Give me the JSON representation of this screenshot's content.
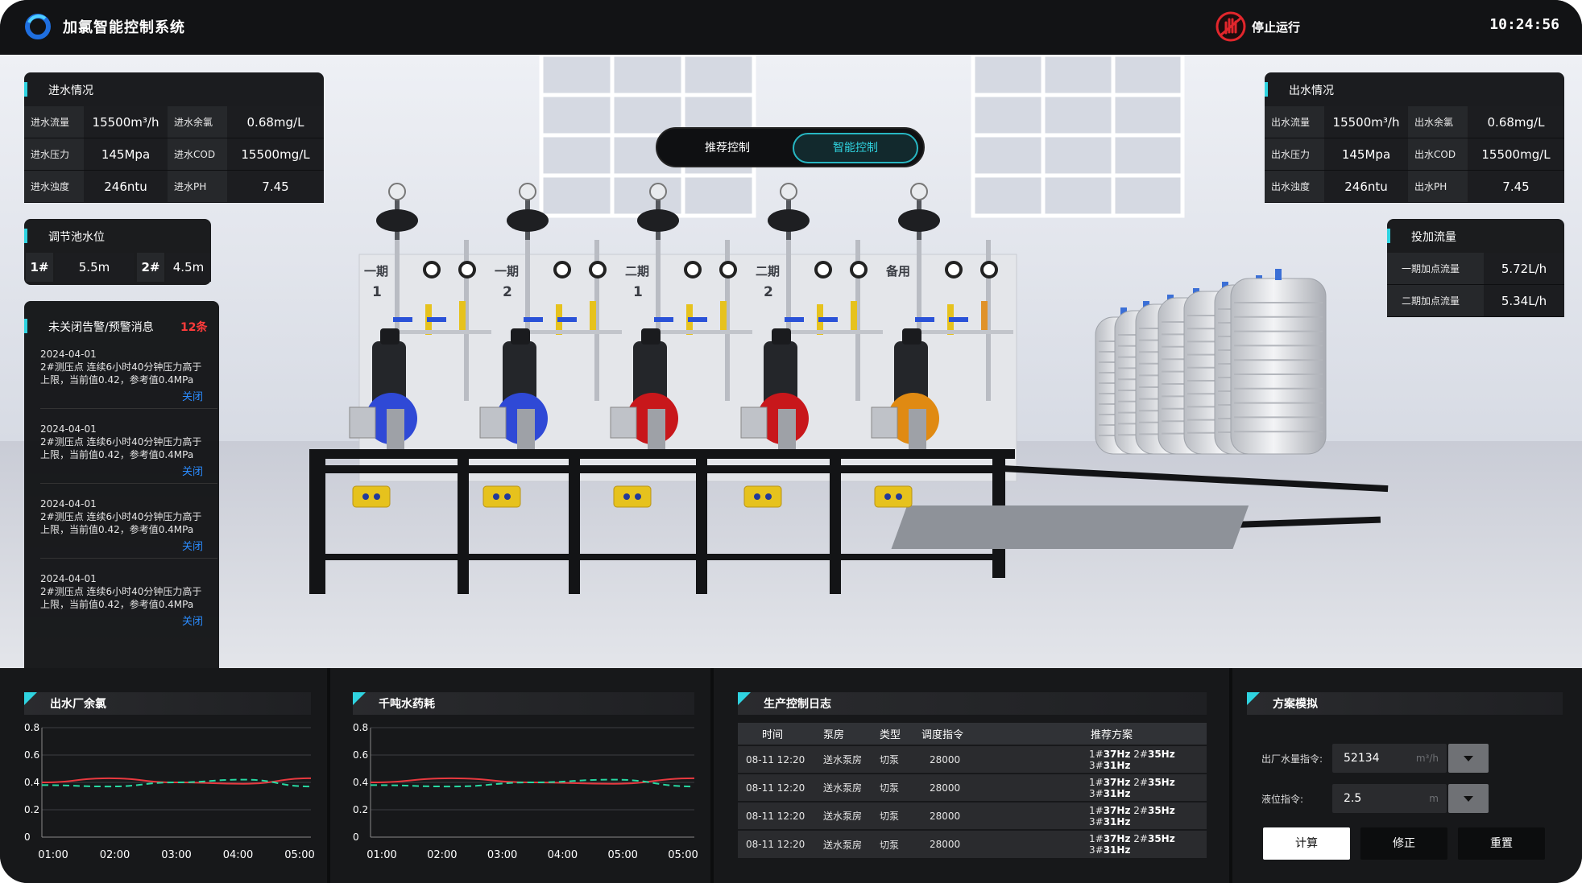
{
  "header": {
    "title": "加氯智能控制系统",
    "stop_label": "停止运行",
    "time": "10:24:56"
  },
  "mode": {
    "recommend": "推荐控制",
    "smart": "智能控制",
    "active": "智能控制"
  },
  "inflow": {
    "title": "进水情况",
    "rows": [
      {
        "k1": "进水流量",
        "v1": "15500m³/h",
        "k2": "进水余氯",
        "v2": "0.68mg/L"
      },
      {
        "k1": "进水压力",
        "v1": "145Mpa",
        "k2": "进水COD",
        "v2": "15500mg/L"
      },
      {
        "k1": "进水浊度",
        "v1": "246ntu",
        "k2": "进水PH",
        "v2": "7.45"
      }
    ]
  },
  "outflow": {
    "title": "出水情况",
    "rows": [
      {
        "k1": "出水流量",
        "v1": "15500m³/h",
        "k2": "出水余氯",
        "v2": "0.68mg/L"
      },
      {
        "k1": "出水压力",
        "v1": "145Mpa",
        "k2": "出水COD",
        "v2": "15500mg/L"
      },
      {
        "k1": "出水浊度",
        "v1": "246ntu",
        "k2": "出水PH",
        "v2": "7.45"
      }
    ]
  },
  "level": {
    "title": "调节池水位",
    "t1": "1#",
    "v1": "5.5m",
    "t2": "2#",
    "v2": "4.5m"
  },
  "dosing": {
    "title": "投加流量",
    "rows": [
      {
        "k": "一期加点流量",
        "v": "5.72L/h"
      },
      {
        "k": "二期加点流量",
        "v": "5.34L/h"
      }
    ]
  },
  "alerts": {
    "title": "未关闭告警/预警消息",
    "count": "12条",
    "items": [
      {
        "date": "2024-04-01",
        "text": "2#测压点 连续6小时40分钟压力高于上限，当前值0.42，参考值0.4MPa",
        "close": "关闭"
      },
      {
        "date": "2024-04-01",
        "text": "2#测压点 连续6小时40分钟压力高于上限，当前值0.42，参考值0.4MPa",
        "close": "关闭"
      },
      {
        "date": "2024-04-01",
        "text": "2#测压点 连续6小时40分钟压力高于上限，当前值0.42，参考值0.4MPa",
        "close": "关闭"
      },
      {
        "date": "2024-04-01",
        "text": "2#测压点 连续6小时40分钟压力高于上限，当前值0.42，参考值0.4MPa",
        "close": "关闭"
      }
    ]
  },
  "scene": {
    "labels": [
      {
        "line1": "一期",
        "line2": "1"
      },
      {
        "line1": "一期",
        "line2": "2"
      },
      {
        "line1": "二期",
        "line2": "1"
      },
      {
        "line1": "二期",
        "line2": "2"
      },
      {
        "line1": "备用",
        "line2": ""
      }
    ],
    "pump_colors": [
      "#2f49d6",
      "#2f49d6",
      "#c8171b",
      "#c8171b",
      "#e08a12"
    ]
  },
  "chart_data": [
    {
      "type": "line",
      "title": "出水厂余氯",
      "x": [
        "01:00",
        "02:00",
        "03:00",
        "04:00",
        "05:00"
      ],
      "ylim": [
        0,
        0.8
      ],
      "yticks": [
        "0",
        "0.2",
        "0.4",
        "0.6",
        "0.8"
      ],
      "series": [
        {
          "values": [
            0.4,
            0.43,
            0.4,
            0.39,
            0.43
          ],
          "color": "#e8393f",
          "style": "solid"
        },
        {
          "values": [
            0.38,
            0.37,
            0.4,
            0.42,
            0.37
          ],
          "color": "#27d9a2",
          "style": "dashed"
        }
      ]
    },
    {
      "type": "line",
      "title": "千吨水药耗",
      "x": [
        "01:00",
        "02:00",
        "03:00",
        "04:00",
        "05:00",
        "05:00"
      ],
      "ylim": [
        0,
        0.8
      ],
      "yticks": [
        "0",
        "0.2",
        "0.4",
        "0.6",
        "0.8"
      ],
      "series": [
        {
          "values": [
            0.4,
            0.43,
            0.4,
            0.39,
            0.43
          ],
          "color": "#e8393f",
          "style": "solid"
        },
        {
          "values": [
            0.38,
            0.37,
            0.4,
            0.42,
            0.37
          ],
          "color": "#27d9a2",
          "style": "dashed"
        }
      ]
    }
  ],
  "log": {
    "title": "生产控制日志",
    "headers": [
      "时间",
      "泵房",
      "类型",
      "调度指令",
      "推荐方案"
    ],
    "rows": [
      {
        "time": "08-11 12:20",
        "room": "送水泵房",
        "type": "切泵",
        "cmd": "28000",
        "plan": [
          "1#",
          "37Hz",
          "2#",
          "35Hz",
          "3#",
          "31Hz"
        ]
      },
      {
        "time": "08-11 12:20",
        "room": "送水泵房",
        "type": "切泵",
        "cmd": "28000",
        "plan": [
          "1#",
          "37Hz",
          "2#",
          "35Hz",
          "3#",
          "31Hz"
        ]
      },
      {
        "time": "08-11 12:20",
        "room": "送水泵房",
        "type": "切泵",
        "cmd": "28000",
        "plan": [
          "1#",
          "37Hz",
          "2#",
          "35Hz",
          "3#",
          "31Hz"
        ]
      },
      {
        "time": "08-11 12:20",
        "room": "送水泵房",
        "type": "切泵",
        "cmd": "28000",
        "plan": [
          "1#",
          "37Hz",
          "2#",
          "35Hz",
          "3#",
          "31Hz"
        ]
      }
    ]
  },
  "sim": {
    "title": "方案模拟",
    "flow_label": "出厂水量指令:",
    "flow_value": "52134",
    "flow_unit": "m³/h",
    "level_label": "液位指令:",
    "level_value": "2.5",
    "level_unit": "m",
    "btn_calc": "计算",
    "btn_fix": "修正",
    "btn_reset": "重置"
  },
  "colors": {
    "accent": "#2fd3e0",
    "alert_count": "#ff3b3b",
    "link": "#2b8cff"
  }
}
